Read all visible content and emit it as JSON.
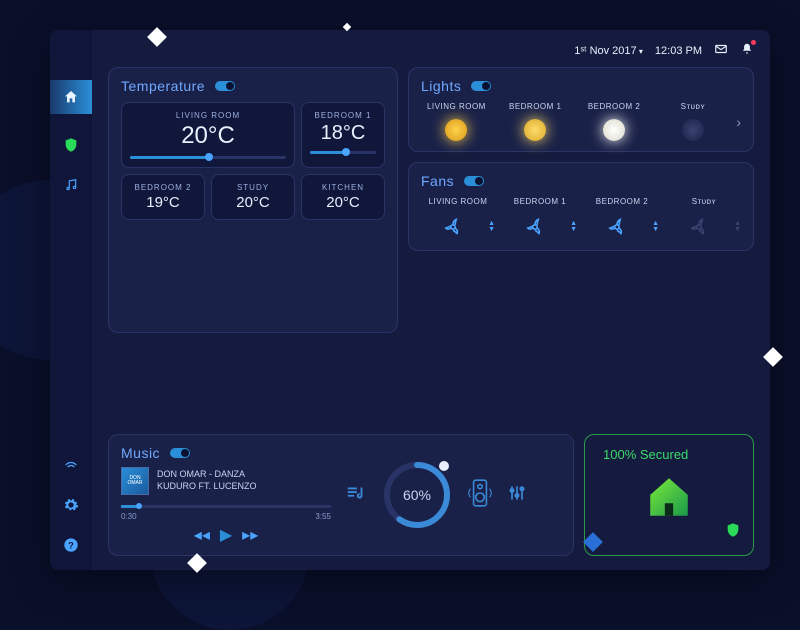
{
  "header": {
    "date": "1ˢᵗ Nov 2017",
    "time": "12:03 PM"
  },
  "sidebar": {
    "items": [
      "home",
      "shield",
      "music",
      "wifi",
      "settings",
      "help"
    ]
  },
  "temperature": {
    "title": "Temperature",
    "rooms": [
      {
        "label": "LIVING ROOM",
        "value": "20°C",
        "slider": true,
        "big": true
      },
      {
        "label": "BEDROOM 1",
        "value": "18°C",
        "slider": true
      },
      {
        "label": "BEDROOM 2",
        "value": "19°C"
      },
      {
        "label": "STUDY",
        "value": "20°C"
      },
      {
        "label": "KITCHEN",
        "value": "20°C"
      }
    ]
  },
  "lights": {
    "title": "Lights",
    "rooms": [
      {
        "label": "LIVING ROOM",
        "state": "on1"
      },
      {
        "label": "BEDROOM 1",
        "state": "on2"
      },
      {
        "label": "BEDROOM 2",
        "state": "on3"
      },
      {
        "label": "Sᴛᴜᴅʏ",
        "state": "off"
      }
    ]
  },
  "fans": {
    "title": "Fans",
    "rooms": [
      {
        "label": "LIVING ROOM",
        "on": true
      },
      {
        "label": "BEDROOM 1",
        "on": true
      },
      {
        "label": "BEDROOM 2",
        "on": true
      },
      {
        "label": "Sᴛᴜᴅʏ",
        "on": false
      }
    ]
  },
  "music": {
    "title": "Music",
    "track_line1": "DON OMAR - DANZA",
    "track_line2": "KUDURO FT. LUCENZO",
    "elapsed": "0:30",
    "total": "3:55",
    "volume_pct": "60%"
  },
  "security": {
    "label": "100% Secured"
  }
}
